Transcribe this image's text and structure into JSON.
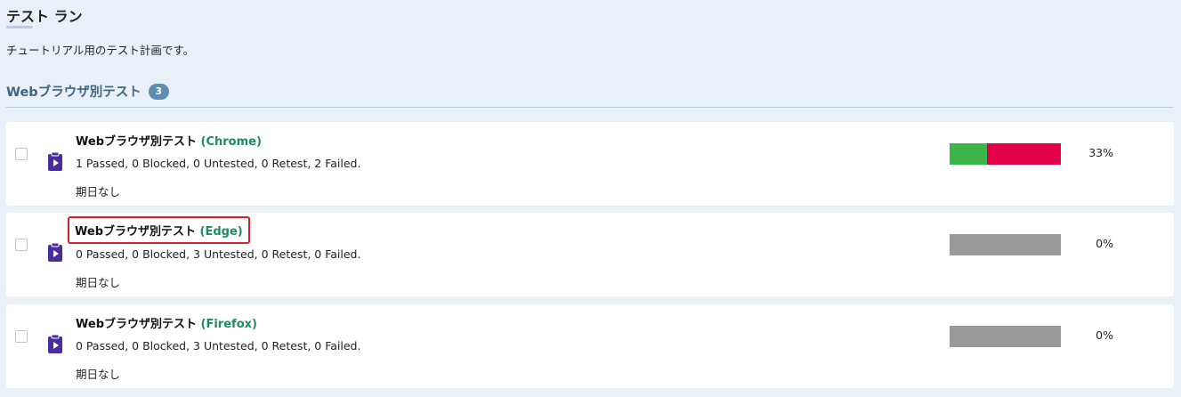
{
  "header": {
    "title": "テスト ラン",
    "description": "チュートリアル用のテスト計画です。"
  },
  "group": {
    "title": "Webブラウザ別テスト",
    "count": "3"
  },
  "colors": {
    "passed": "#3bb54a",
    "failed": "#e3004b",
    "untested": "#9a9a9a"
  },
  "runs": [
    {
      "name_prefix": "Webブラウザ別テスト",
      "browser": "(Chrome)",
      "stats": "1 Passed, 0 Blocked, 0 Untested, 0 Retest, 2 Failed.",
      "due": "期日なし",
      "percent": "33%",
      "passed": 1,
      "blocked": 0,
      "untested": 0,
      "retest": 0,
      "failed": 2
    },
    {
      "name_prefix": "Webブラウザ別テスト",
      "browser": "(Edge)",
      "stats": "0 Passed, 0 Blocked, 3 Untested, 0 Retest, 0 Failed.",
      "due": "期日なし",
      "percent": "0%",
      "passed": 0,
      "blocked": 0,
      "untested": 3,
      "retest": 0,
      "failed": 0
    },
    {
      "name_prefix": "Webブラウザ別テスト",
      "browser": "(Firefox)",
      "stats": "0 Passed, 0 Blocked, 3 Untested, 0 Retest, 0 Failed.",
      "due": "期日なし",
      "percent": "0%",
      "passed": 0,
      "blocked": 0,
      "untested": 3,
      "retest": 0,
      "failed": 0
    }
  ]
}
